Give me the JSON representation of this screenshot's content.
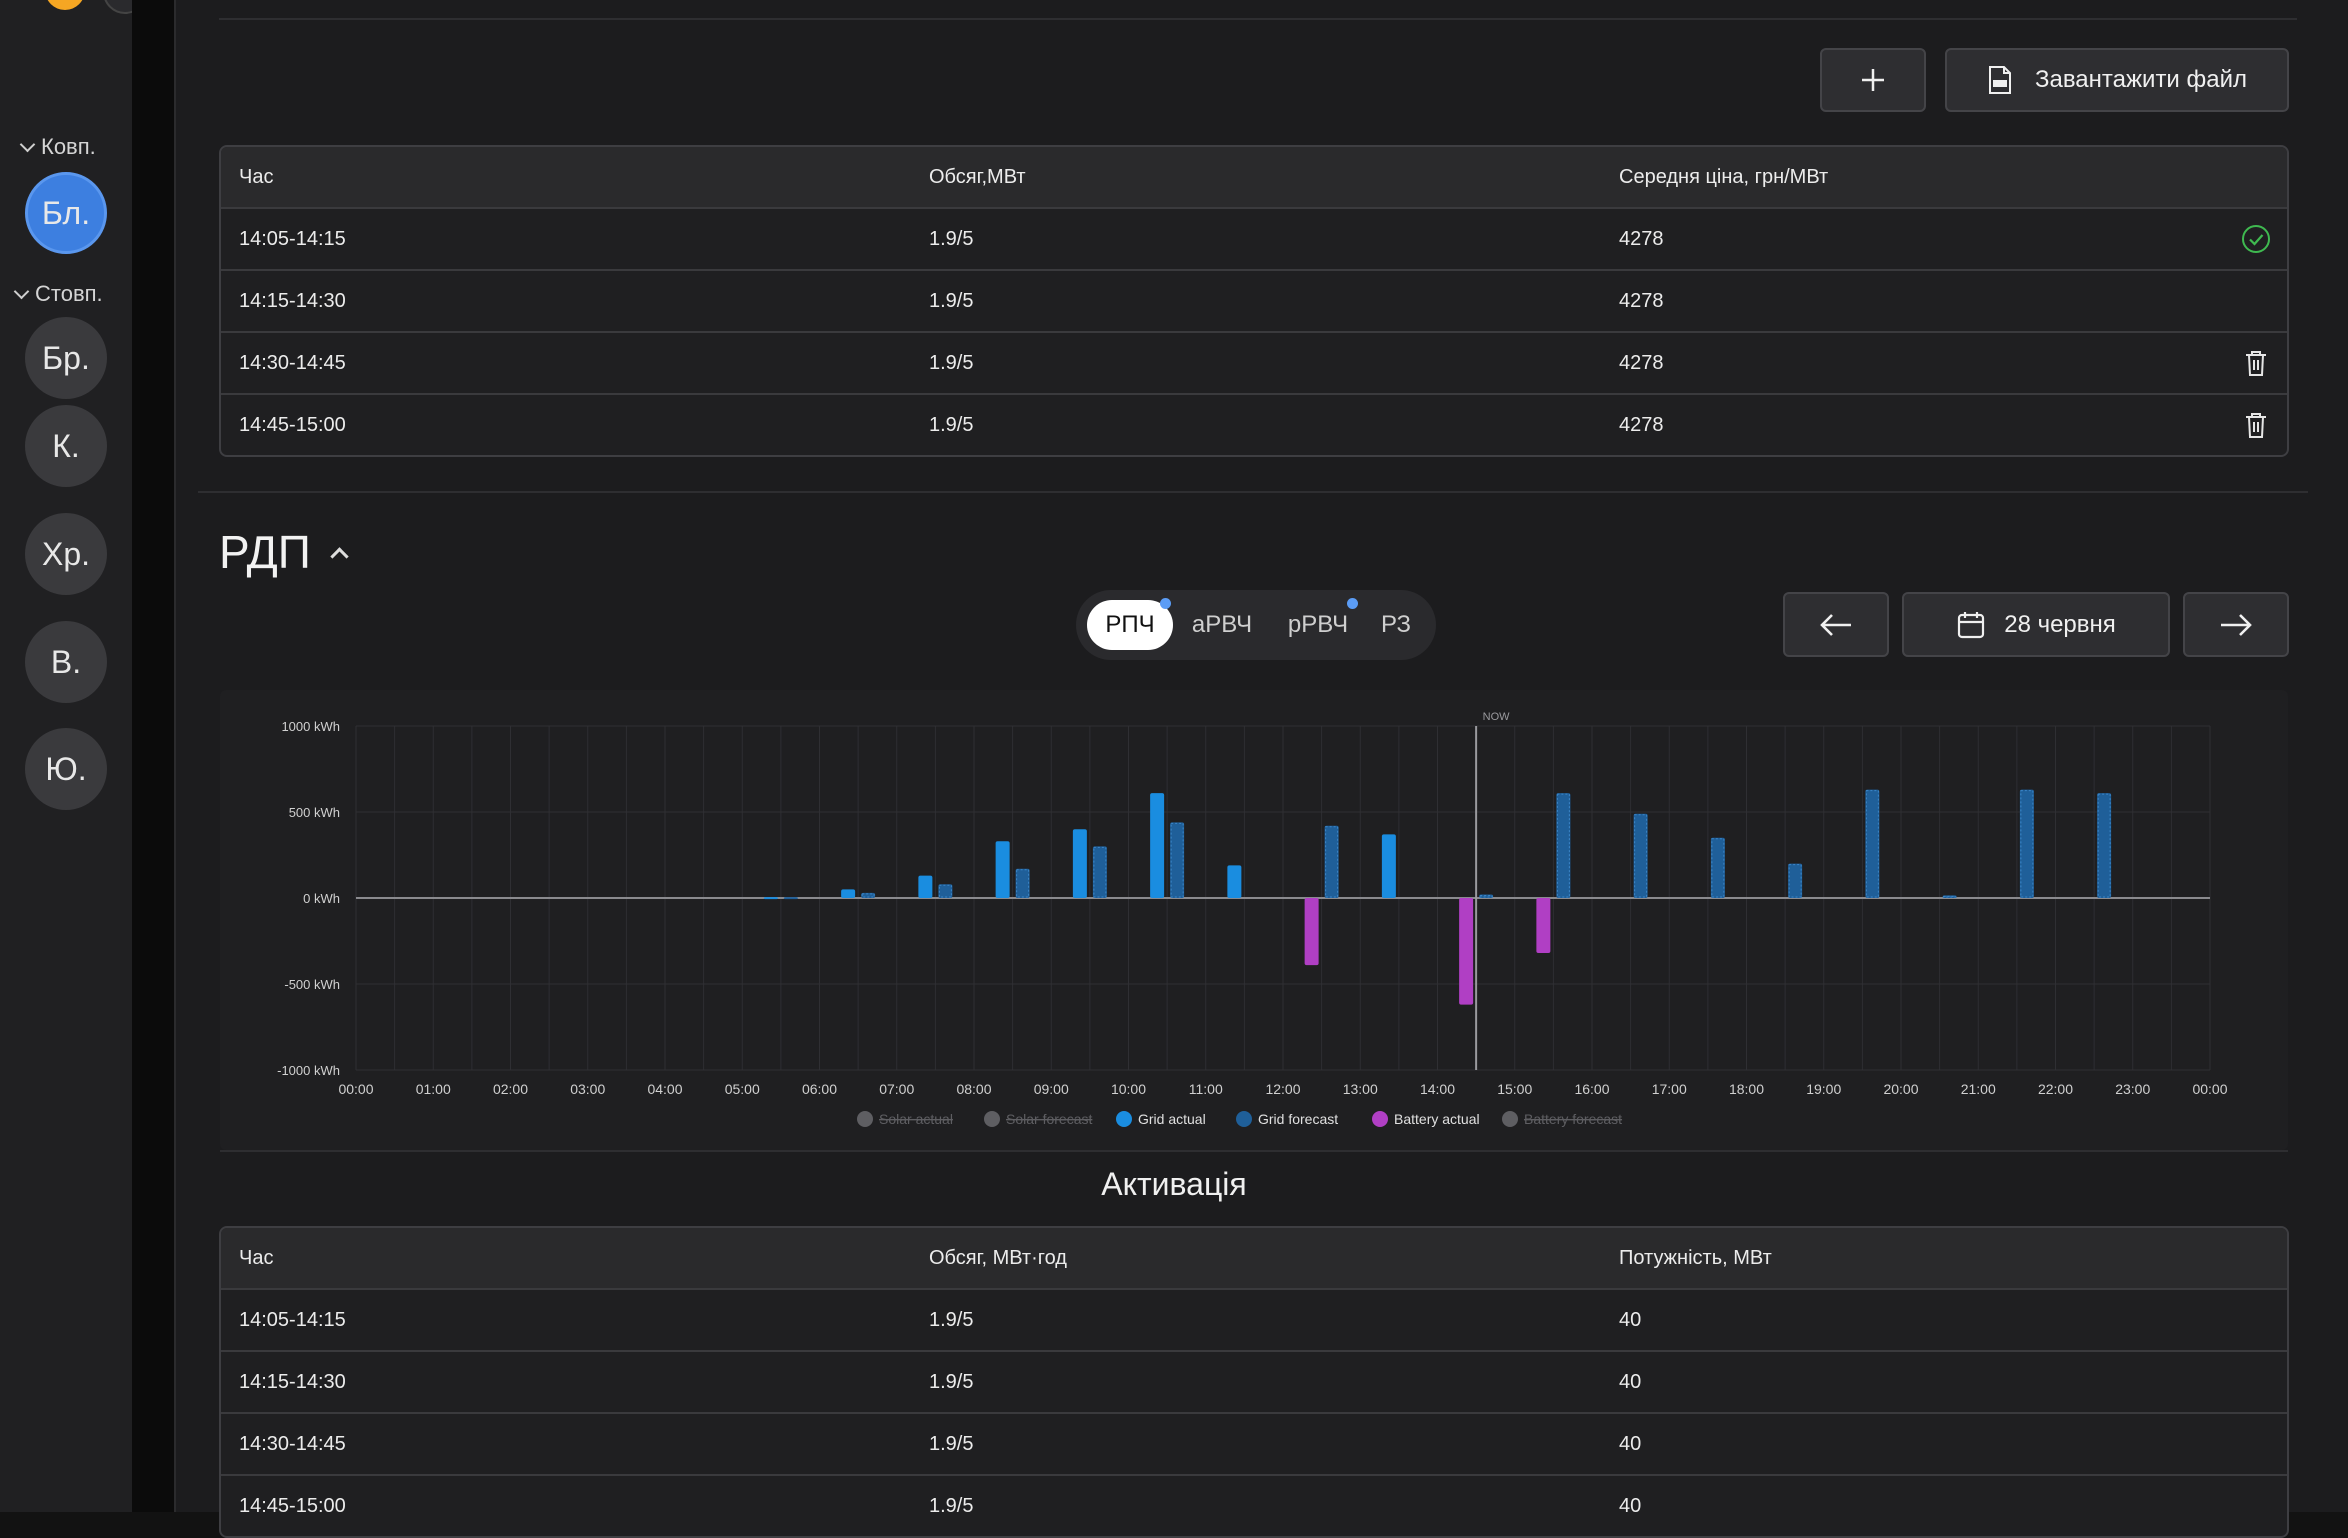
{
  "sidebar": {
    "groups": [
      {
        "label": "Ковп.",
        "items": [
          {
            "label": "Бл.",
            "active": true
          }
        ]
      },
      {
        "label": "Стовп.",
        "items": [
          {
            "label": "Бр."
          },
          {
            "label": "К."
          },
          {
            "label": "Хр."
          },
          {
            "label": "В."
          },
          {
            "label": "Ю."
          }
        ]
      }
    ]
  },
  "toolbar": {
    "add_icon": "plus-icon",
    "upload_label": "Завантажити файл",
    "upload_icon": "xls-file-icon"
  },
  "bids_table": {
    "columns": [
      "Час",
      "Обсяг,МВт",
      "Середня ціна, грн/МВт"
    ],
    "rows": [
      {
        "time": "14:05-14:15",
        "volume": "1.9/5",
        "price": "4278",
        "status": "check"
      },
      {
        "time": "14:15-14:30",
        "volume": "1.9/5",
        "price": "4278",
        "status": ""
      },
      {
        "time": "14:30-14:45",
        "volume": "1.9/5",
        "price": "4278",
        "status": "delete"
      },
      {
        "time": "14:45-15:00",
        "volume": "1.9/5",
        "price": "4278",
        "status": "delete"
      }
    ]
  },
  "rdp": {
    "title": "РДП",
    "tabs": [
      {
        "label": "РПЧ",
        "active": true,
        "dot": true
      },
      {
        "label": "аРВЧ",
        "active": false,
        "dot": false
      },
      {
        "label": "рРВЧ",
        "active": false,
        "dot": true
      },
      {
        "label": "РЗ",
        "active": false,
        "dot": false
      }
    ],
    "date_label": "28 червня",
    "colors": {
      "accent_dot": "#5b9cf5",
      "grid_actual": "#1a8de0",
      "grid_forecast": "#1f5f99",
      "battery_actual": "#b03fc4",
      "muted": "#5e5e62"
    }
  },
  "chart_data": {
    "type": "bar",
    "x": [
      "00:00",
      "01:00",
      "02:00",
      "03:00",
      "04:00",
      "05:00",
      "06:00",
      "07:00",
      "08:00",
      "09:00",
      "10:00",
      "11:00",
      "12:00",
      "13:00",
      "14:00",
      "15:00",
      "16:00",
      "17:00",
      "18:00",
      "19:00",
      "20:00",
      "21:00",
      "22:00",
      "23:00",
      "00:00"
    ],
    "ylim": [
      -1000,
      1000
    ],
    "yticks": [
      1000,
      500,
      0,
      -500,
      -1000
    ],
    "ytick_labels": [
      "1000 kWh",
      "500 kWh",
      "0 kWh",
      "-500 kWh",
      "-1000 kWh"
    ],
    "now_label": "NOW",
    "now_hour": 14.5,
    "series": [
      {
        "name": "Solar actual",
        "legend_color": "#5e5e62",
        "disabled": true,
        "values": []
      },
      {
        "name": "Solar forecast",
        "legend_color": "#5e5e62",
        "disabled": true,
        "values": []
      },
      {
        "name": "Grid actual",
        "legend_color": "#1a8de0",
        "disabled": false,
        "values": [
          0,
          0,
          0,
          0,
          0,
          5,
          50,
          130,
          330,
          400,
          610,
          190,
          0,
          370,
          0,
          0,
          0,
          0,
          0,
          0,
          0,
          0,
          0,
          0
        ]
      },
      {
        "name": "Grid forecast",
        "legend_color": "#1f5f99",
        "disabled": false,
        "values": [
          0,
          0,
          0,
          0,
          0,
          5,
          30,
          80,
          170,
          300,
          440,
          0,
          420,
          0,
          20,
          610,
          490,
          350,
          200,
          630,
          15,
          630,
          610,
          0
        ]
      },
      {
        "name": "Battery actual",
        "legend_color": "#b03fc4",
        "disabled": false,
        "values": [
          0,
          0,
          0,
          0,
          0,
          0,
          0,
          0,
          0,
          0,
          0,
          0,
          -390,
          0,
          -620,
          -320,
          0,
          0,
          0,
          0,
          0,
          0,
          0,
          0
        ]
      },
      {
        "name": "Battery forecast",
        "legend_color": "#5e5e62",
        "disabled": true,
        "values": []
      }
    ]
  },
  "activation": {
    "title": "Активація",
    "columns": [
      "Час",
      "Обсяг, МВт·год",
      "Потужність, МВт"
    ],
    "rows": [
      {
        "time": "14:05-14:15",
        "volume": "1.9/5",
        "power": "40"
      },
      {
        "time": "14:15-14:30",
        "volume": "1.9/5",
        "power": "40"
      },
      {
        "time": "14:30-14:45",
        "volume": "1.9/5",
        "power": "40"
      },
      {
        "time": "14:45-15:00",
        "volume": "1.9/5",
        "power": "40"
      }
    ]
  }
}
